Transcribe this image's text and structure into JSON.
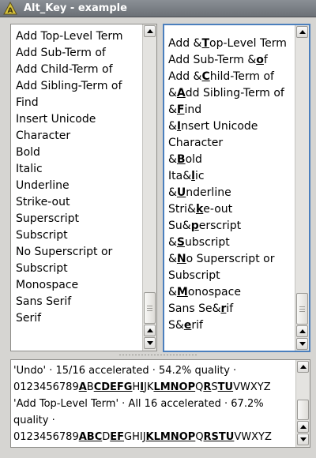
{
  "window": {
    "title": "Alt_Key - example"
  },
  "left_list": {
    "items": [
      "Add Top-Level Term",
      "Add Sub-Term of",
      "Add Child-Term of",
      "Add Sibling-Term of",
      "Find",
      "Insert Unicode",
      "Character",
      "Bold",
      "Italic",
      "Underline",
      "Strike-out",
      "Superscript",
      "Subscript",
      "No Superscript or",
      "Subscript",
      "Monospace",
      "Sans Serif",
      "Serif"
    ]
  },
  "right_list": {
    "items": [
      {
        "pre": "Add &",
        "acc": "T",
        "post": "op-Level Term"
      },
      {
        "pre": "Add Sub-Term &",
        "acc": "o",
        "post": "f"
      },
      {
        "pre": "Add &",
        "acc": "C",
        "post": "hild-Term of"
      },
      {
        "pre": "&",
        "acc": "A",
        "post": "dd Sibling-Term of"
      },
      {
        "pre": "&",
        "acc": "F",
        "post": "ind"
      },
      {
        "pre": "&",
        "acc": "I",
        "post": "nsert Unicode"
      },
      {
        "pre": "Character",
        "acc": "",
        "post": ""
      },
      {
        "pre": "&",
        "acc": "B",
        "post": "old"
      },
      {
        "pre": "Ita&",
        "acc": "l",
        "post": "ic"
      },
      {
        "pre": "&",
        "acc": "U",
        "post": "nderline"
      },
      {
        "pre": "Stri&",
        "acc": "k",
        "post": "e-out"
      },
      {
        "pre": "Su&",
        "acc": "p",
        "post": "erscript"
      },
      {
        "pre": "&",
        "acc": "S",
        "post": "ubscript"
      },
      {
        "pre": "&",
        "acc": "N",
        "post": "o Superscript or"
      },
      {
        "pre": "Subscript",
        "acc": "",
        "post": ""
      },
      {
        "pre": "&",
        "acc": "M",
        "post": "onospace"
      },
      {
        "pre": "Sans Se&",
        "acc": "r",
        "post": "if"
      },
      {
        "pre": "S&",
        "acc": "e",
        "post": "rif"
      }
    ]
  },
  "log": {
    "lines": [
      [
        {
          "t": "'Undo' · 15/16 accelerated · 54.2% quality ·"
        }
      ],
      [
        {
          "t": "0123456789"
        },
        {
          "t": "A",
          "u": true
        },
        {
          "t": "B"
        },
        {
          "t": "CDEFG",
          "u": true
        },
        {
          "t": "H"
        },
        {
          "t": "I",
          "u": true
        },
        {
          "t": "JK"
        },
        {
          "t": "LMNOP",
          "u": true
        },
        {
          "t": "Q"
        },
        {
          "t": "R",
          "u": true
        },
        {
          "t": "S"
        },
        {
          "t": "TU",
          "u": true
        },
        {
          "t": "VWXYZ"
        }
      ],
      [
        {
          "t": "'Add Top-Level Term' · All 16 accelerated · 67.2%"
        }
      ],
      [
        {
          "t": "quality ·"
        }
      ],
      [
        {
          "t": "0123456789"
        },
        {
          "t": "ABC",
          "u": true
        },
        {
          "t": "D"
        },
        {
          "t": "EF",
          "u": true
        },
        {
          "t": "GHIJ"
        },
        {
          "t": "KLMNOP",
          "u": true
        },
        {
          "t": "Q"
        },
        {
          "t": "RSTU",
          "u": true
        },
        {
          "t": "VWXYZ"
        }
      ]
    ]
  }
}
